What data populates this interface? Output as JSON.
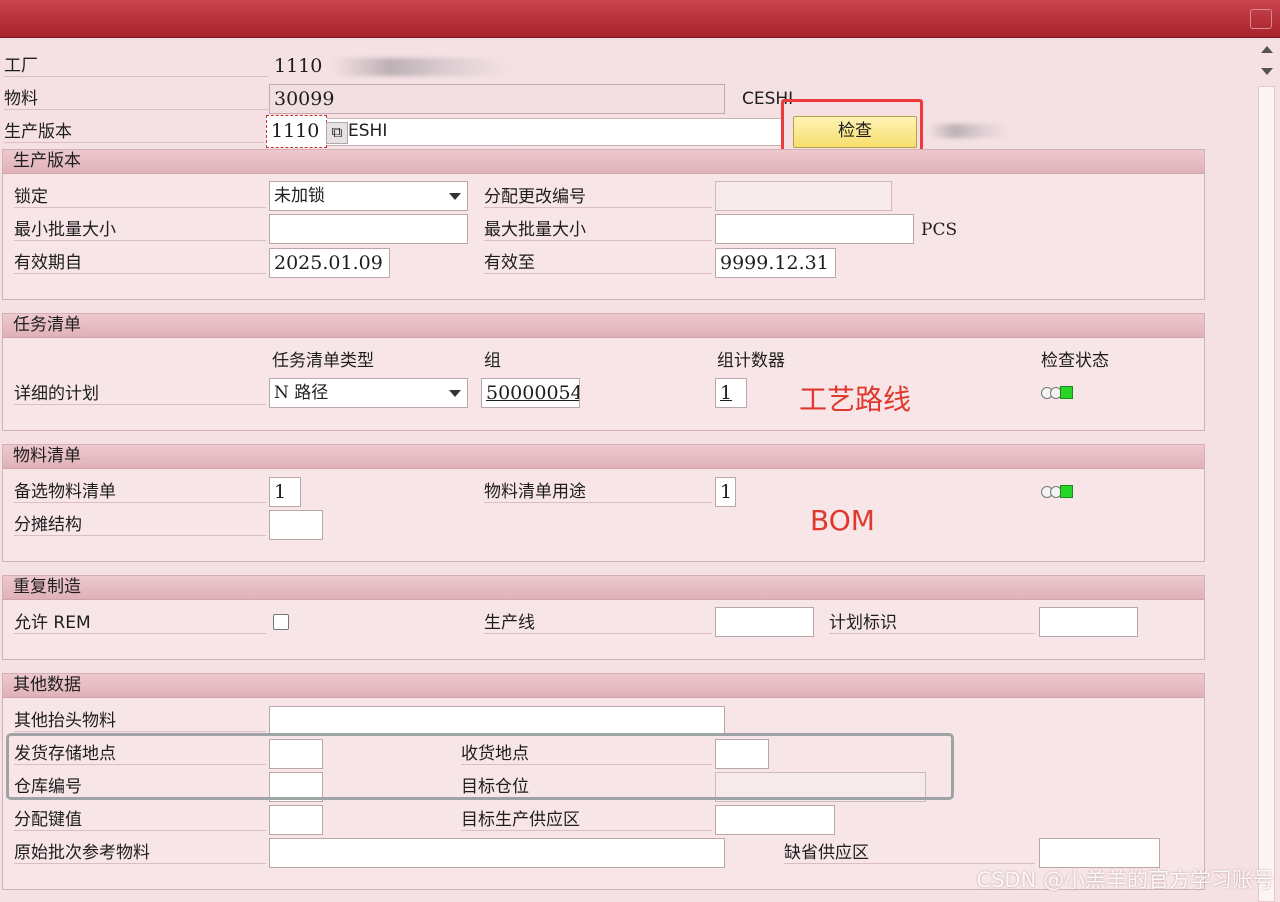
{
  "header": {
    "plant_label": "工厂",
    "plant_value": "1110",
    "material_label": "物料",
    "material_value": "30099",
    "material_desc": "CESHI",
    "version_label": "生产版本",
    "version_value": "1110",
    "version_desc": "ESHI",
    "check_button": "检查"
  },
  "prod_version": {
    "title": "生产版本",
    "lock_label": "锁定",
    "lock_value": "未加锁",
    "change_no_label": "分配更改编号",
    "change_no_value": "",
    "min_lot_label": "最小批量大小",
    "min_lot_value": "",
    "max_lot_label": "最大批量大小",
    "max_lot_value": "",
    "unit": "PCS",
    "valid_from_label": "有效期自",
    "valid_from_value": "2025.01.09",
    "valid_to_label": "有效至",
    "valid_to_value": "9999.12.31"
  },
  "task_list": {
    "title": "任务清单",
    "col_type": "任务清单类型",
    "col_group": "组",
    "col_counter": "组计数器",
    "col_status": "检查状态",
    "row_label": "详细的计划",
    "type_value": "N 路径",
    "group_value": "50000054",
    "counter_value": "1",
    "annotation": "工艺路线",
    "status_light": "green-light-icon"
  },
  "bom": {
    "title": "物料清单",
    "alt_label": "备选物料清单",
    "alt_value": "1",
    "usage_label": "物料清单用途",
    "usage_value": "1",
    "apportion_label": "分摊结构",
    "apportion_value": "",
    "annotation": "BOM",
    "status_light": "green-light-icon"
  },
  "rem": {
    "title": "重复制造",
    "allow_label": "允许 REM",
    "line_label": "生产线",
    "line_value": "",
    "plan_id_label": "计划标识",
    "plan_id_value": ""
  },
  "other": {
    "title": "其他数据",
    "header_mat_label": "其他抬头物料",
    "issue_sloc_label": "发货存储地点",
    "receive_label": "收货地点",
    "warehouse_label": "仓库编号",
    "dest_bin_label": "目标仓位",
    "assign_key_label": "分配键值",
    "target_supply_label": "目标生产供应区",
    "orig_batch_label": "原始批次参考物料",
    "default_supply_label": "缺省供应区"
  },
  "watermark": "CSDN @小羔羊的官方学习账号",
  "colors": {
    "accent_red": "#e0382c",
    "status_green": "#27d527",
    "title_bar": "#b3303a"
  }
}
